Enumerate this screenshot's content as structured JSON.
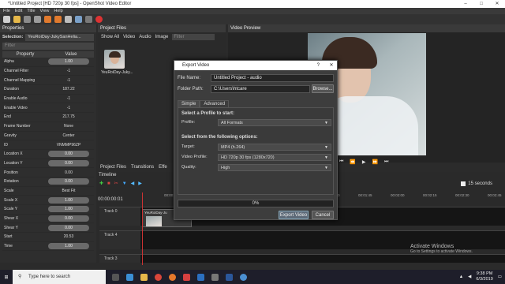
{
  "window": {
    "title": "*Untitled Project [HD 720p 30 fps] - OpenShot Video Editor"
  },
  "menu": [
    "File",
    "Edit",
    "Title",
    "View",
    "Help"
  ],
  "properties": {
    "header": "Properties",
    "selection_label": "Selection:",
    "selection_value": "YeuRoiDay-JukySanHelia...",
    "filter_placeholder": "Filter",
    "col_property": "Property",
    "col_value": "Value",
    "rows": [
      {
        "name": "Alpha",
        "value": "1.00",
        "pill": true
      },
      {
        "name": "Channel Filter",
        "value": "-1",
        "pill": false
      },
      {
        "name": "Channel Mapping",
        "value": "-1",
        "pill": false
      },
      {
        "name": "Duration",
        "value": "187.22",
        "pill": false
      },
      {
        "name": "Enable Audio",
        "value": "-1",
        "pill": false
      },
      {
        "name": "Enable Video",
        "value": "-1",
        "pill": false
      },
      {
        "name": "End",
        "value": "217.75",
        "pill": false
      },
      {
        "name": "Frame Number",
        "value": "None",
        "pill": false
      },
      {
        "name": "Gravity",
        "value": "Center",
        "pill": false
      },
      {
        "name": "ID",
        "value": "VNMMP96ZP",
        "pill": false
      },
      {
        "name": "Location X",
        "value": "0.00",
        "pill": true
      },
      {
        "name": "Location Y",
        "value": "0.00",
        "pill": true
      },
      {
        "name": "Position",
        "value": "0.00",
        "pill": false
      },
      {
        "name": "Rotation",
        "value": "0.00",
        "pill": true
      },
      {
        "name": "Scale",
        "value": "Best Fit",
        "pill": false
      },
      {
        "name": "Scale X",
        "value": "1.00",
        "pill": true
      },
      {
        "name": "Scale Y",
        "value": "1.00",
        "pill": true
      },
      {
        "name": "Shear X",
        "value": "0.00",
        "pill": true
      },
      {
        "name": "Shear Y",
        "value": "0.00",
        "pill": true
      },
      {
        "name": "Start",
        "value": "20.53",
        "pill": false
      },
      {
        "name": "Time",
        "value": "1.00",
        "pill": true
      }
    ]
  },
  "project_files": {
    "header": "Project Files",
    "tabs": [
      "Show All",
      "Video",
      "Audio",
      "Image"
    ],
    "filter_placeholder": "Filter",
    "file_name": "YeuRoiDay-Juky..."
  },
  "video_preview": {
    "header": "Video Preview"
  },
  "bottom_tabs": [
    "Project Files",
    "Transitions",
    "Effe"
  ],
  "timeline": {
    "header": "Timeline",
    "timecode": "00:00:00:01",
    "zoom_label": "15 seconds",
    "ruler": [
      "00:00:15",
      "00:00:30",
      "00:00:45",
      "00:01:00",
      "00:01:15",
      "00:01:30",
      "00:01:45",
      "00:02:00",
      "00:02:15",
      "00:02:30",
      "00:02:45"
    ],
    "tracks": [
      "Track 0",
      "Track 4",
      "Track 3"
    ],
    "clip_label": "YeuRoiDay-Ju"
  },
  "export_dialog": {
    "title": "Export Video",
    "file_name_label": "File Name:",
    "file_name_value": "Untitled Project - audio",
    "folder_path_label": "Folder Path:",
    "folder_path_value": "C:\\Users\\htcare",
    "browse_label": "Browse...",
    "tab_simple": "Simple",
    "tab_advanced": "Advanced",
    "section_profile": "Select a Profile to start:",
    "profile_label": "Profile:",
    "profile_value": "All Formats",
    "section_options": "Select from the following options:",
    "target_label": "Target:",
    "target_value": "MP4 (h.264)",
    "video_profile_label": "Video Profile:",
    "video_profile_value": "HD 720p 30 fps (1280x720)",
    "quality_label": "Quality:",
    "quality_value": "High",
    "progress_text": "0%",
    "export_button": "Export Video",
    "cancel_button": "Cancel"
  },
  "watermark": {
    "title": "Activate Windows",
    "subtitle": "Go to Settings to activate Windows."
  },
  "taskbar": {
    "search_placeholder": "Type here to search",
    "time": "9:38 PM",
    "date": "6/3/2019"
  }
}
